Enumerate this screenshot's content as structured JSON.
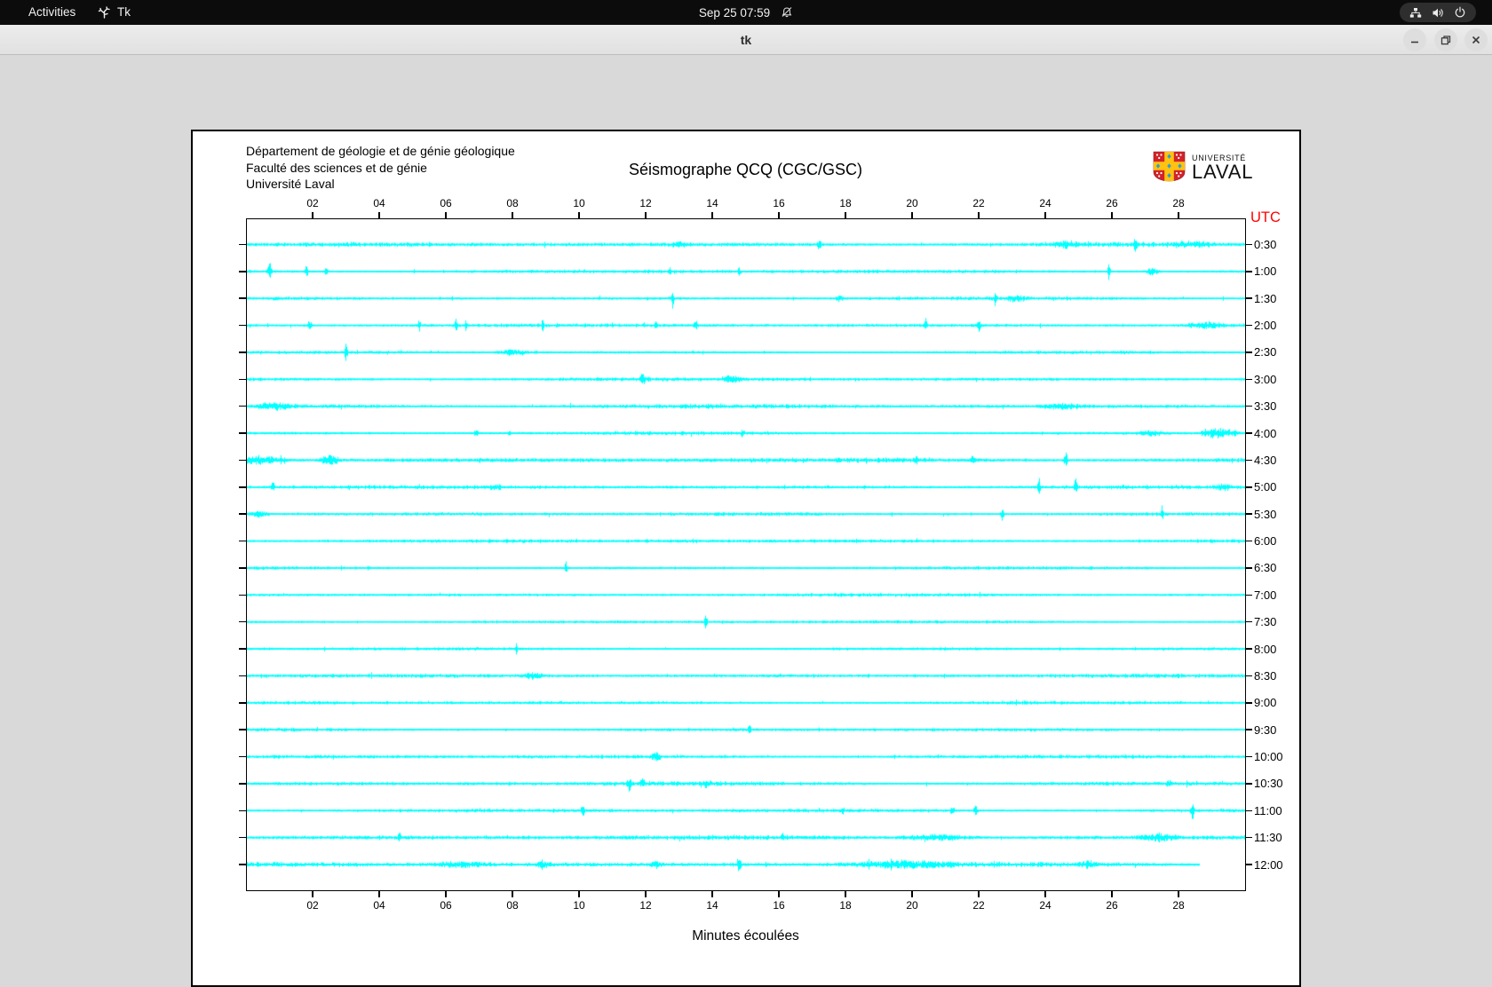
{
  "top_bar": {
    "activities": "Activities",
    "app_name": "Tk",
    "clock": "Sep 25 07:59",
    "icons": [
      "tk-app-icon",
      "notifications-disabled-icon",
      "network-icon",
      "volume-icon",
      "power-icon"
    ]
  },
  "titlebar": {
    "title": "tk",
    "buttons": [
      "minimize",
      "maximize",
      "close"
    ]
  },
  "seismograph": {
    "header_lines": [
      "Département de géologie et de génie géologique",
      "Faculté des sciences et de génie",
      "Université Laval"
    ],
    "title": "Séismographe QCQ (CGC/GSC)",
    "logo": {
      "line1": "UNIVERSITÉ",
      "line2": "LAVAL"
    },
    "utc_label": "UTC",
    "xlabel": "Minutes écoulées",
    "trace_color": "#00ffff",
    "utc_color": "#ff0000"
  },
  "chart_data": {
    "type": "line",
    "title": "Séismographe QCQ (CGC/GSC)",
    "xlabel": "Minutes écoulées",
    "x_range_minutes": [
      0,
      30
    ],
    "x_ticks": [
      "02",
      "04",
      "06",
      "08",
      "10",
      "12",
      "14",
      "16",
      "18",
      "20",
      "22",
      "24",
      "26",
      "28"
    ],
    "x_tick_minutes": [
      2,
      4,
      6,
      8,
      10,
      12,
      14,
      16,
      18,
      20,
      22,
      24,
      26,
      28
    ],
    "row_axis_label": "UTC",
    "legend": "none",
    "grid": false,
    "rows": [
      {
        "label": "0:30",
        "end_minute": 30,
        "noise": 1.5,
        "events": [
          [
            13.0,
            3,
            0.3
          ],
          [
            17.2,
            8,
            0.07
          ],
          [
            24.6,
            3.5,
            0.6
          ],
          [
            26.7,
            14,
            0.07
          ],
          [
            28.3,
            3,
            0.9
          ]
        ]
      },
      {
        "label": "1:00",
        "end_minute": 30,
        "noise": 1.3,
        "events": [
          [
            0.7,
            12,
            0.09
          ],
          [
            1.8,
            9,
            0.07
          ],
          [
            2.4,
            6,
            0.07
          ],
          [
            12.7,
            5,
            0.07
          ],
          [
            14.8,
            5,
            0.07
          ],
          [
            25.9,
            13,
            0.06
          ],
          [
            27.2,
            4,
            0.3
          ]
        ]
      },
      {
        "label": "1:30",
        "end_minute": 30,
        "noise": 1.2,
        "events": [
          [
            12.8,
            13,
            0.06
          ],
          [
            17.8,
            4,
            0.15
          ],
          [
            22.5,
            11,
            0.07
          ],
          [
            23.1,
            4,
            0.4
          ]
        ]
      },
      {
        "label": "2:00",
        "end_minute": 30,
        "noise": 1.3,
        "events": [
          [
            1.9,
            8,
            0.09
          ],
          [
            5.2,
            10,
            0.05
          ],
          [
            6.3,
            11,
            0.05
          ],
          [
            6.6,
            9,
            0.05
          ],
          [
            8.9,
            12,
            0.05
          ],
          [
            12.3,
            10,
            0.05
          ],
          [
            13.5,
            6,
            0.1
          ],
          [
            20.4,
            9,
            0.06
          ],
          [
            22.0,
            10,
            0.07
          ],
          [
            28.8,
            4,
            0.7
          ]
        ]
      },
      {
        "label": "2:30",
        "end_minute": 30,
        "noise": 1.1,
        "events": [
          [
            3.0,
            13,
            0.06
          ],
          [
            8.0,
            3.5,
            0.6
          ]
        ]
      },
      {
        "label": "3:00",
        "end_minute": 30,
        "noise": 1.3,
        "events": [
          [
            11.9,
            9,
            0.09
          ],
          [
            14.6,
            4.5,
            0.4
          ]
        ]
      },
      {
        "label": "3:30",
        "end_minute": 30,
        "noise": 1.5,
        "events": [
          [
            0.9,
            3.5,
            0.8
          ],
          [
            24.5,
            3,
            0.8
          ]
        ]
      },
      {
        "label": "4:00",
        "end_minute": 30,
        "noise": 1.2,
        "events": [
          [
            6.9,
            6,
            0.07
          ],
          [
            7.9,
            5,
            0.07
          ],
          [
            14.9,
            6,
            0.07
          ],
          [
            27.2,
            3,
            0.5
          ],
          [
            29.2,
            7,
            0.7
          ]
        ]
      },
      {
        "label": "4:30",
        "end_minute": 30,
        "noise": 1.7,
        "events": [
          [
            0.4,
            4.5,
            1.0
          ],
          [
            2.5,
            7,
            0.4
          ],
          [
            20.1,
            5,
            0.1
          ],
          [
            21.8,
            5,
            0.1
          ],
          [
            24.6,
            13,
            0.07
          ]
        ]
      },
      {
        "label": "5:00",
        "end_minute": 30,
        "noise": 1.4,
        "events": [
          [
            0.8,
            7,
            0.07
          ],
          [
            7.5,
            3.5,
            0.3
          ],
          [
            23.8,
            14,
            0.06
          ],
          [
            24.9,
            12,
            0.06
          ],
          [
            29.3,
            4,
            0.3
          ]
        ]
      },
      {
        "label": "5:30",
        "end_minute": 30,
        "noise": 1.3,
        "events": [
          [
            0.4,
            3.5,
            0.4
          ],
          [
            22.7,
            9,
            0.07
          ],
          [
            27.5,
            12,
            0.06
          ]
        ]
      },
      {
        "label": "6:00",
        "end_minute": 30,
        "noise": 1.3,
        "events": []
      },
      {
        "label": "6:30",
        "end_minute": 30,
        "noise": 1.1,
        "events": [
          [
            9.6,
            10,
            0.06
          ]
        ]
      },
      {
        "label": "7:00",
        "end_minute": 30,
        "noise": 1.2,
        "events": []
      },
      {
        "label": "7:30",
        "end_minute": 30,
        "noise": 1.1,
        "events": [
          [
            13.8,
            11,
            0.06
          ]
        ]
      },
      {
        "label": "8:00",
        "end_minute": 30,
        "noise": 1.1,
        "events": [
          [
            8.1,
            10,
            0.06
          ]
        ]
      },
      {
        "label": "8:30",
        "end_minute": 30,
        "noise": 1.3,
        "events": [
          [
            8.6,
            3.5,
            0.5
          ]
        ]
      },
      {
        "label": "9:00",
        "end_minute": 30,
        "noise": 1.2,
        "events": []
      },
      {
        "label": "9:30",
        "end_minute": 30,
        "noise": 1.2,
        "events": [
          [
            15.1,
            10,
            0.06
          ]
        ]
      },
      {
        "label": "10:00",
        "end_minute": 30,
        "noise": 1.3,
        "events": [
          [
            12.3,
            5,
            0.2
          ]
        ]
      },
      {
        "label": "10:30",
        "end_minute": 30,
        "noise": 1.5,
        "events": [
          [
            11.5,
            8,
            0.09
          ],
          [
            11.9,
            7,
            0.09
          ],
          [
            13.8,
            5,
            0.07
          ],
          [
            27.7,
            5,
            0.1
          ]
        ]
      },
      {
        "label": "11:00",
        "end_minute": 30,
        "noise": 1.3,
        "events": [
          [
            10.1,
            8,
            0.07
          ],
          [
            17.9,
            6,
            0.07
          ],
          [
            21.2,
            6,
            0.09
          ],
          [
            21.9,
            6,
            0.09
          ],
          [
            28.4,
            16,
            0.07
          ]
        ]
      },
      {
        "label": "11:30",
        "end_minute": 30,
        "noise": 1.6,
        "events": [
          [
            4.6,
            9,
            0.06
          ],
          [
            16.1,
            5,
            0.07
          ],
          [
            20.8,
            3.5,
            1.4
          ],
          [
            27.4,
            3.5,
            0.8
          ]
        ]
      },
      {
        "label": "12:00",
        "end_minute": 28.6,
        "noise": 1.7,
        "events": [
          [
            6.4,
            3,
            1.2
          ],
          [
            8.9,
            3.5,
            0.3
          ],
          [
            12.3,
            4,
            0.2
          ],
          [
            14.8,
            12,
            0.07
          ],
          [
            19.8,
            3.5,
            2.2
          ],
          [
            25.3,
            3.5,
            0.3
          ]
        ]
      }
    ]
  }
}
